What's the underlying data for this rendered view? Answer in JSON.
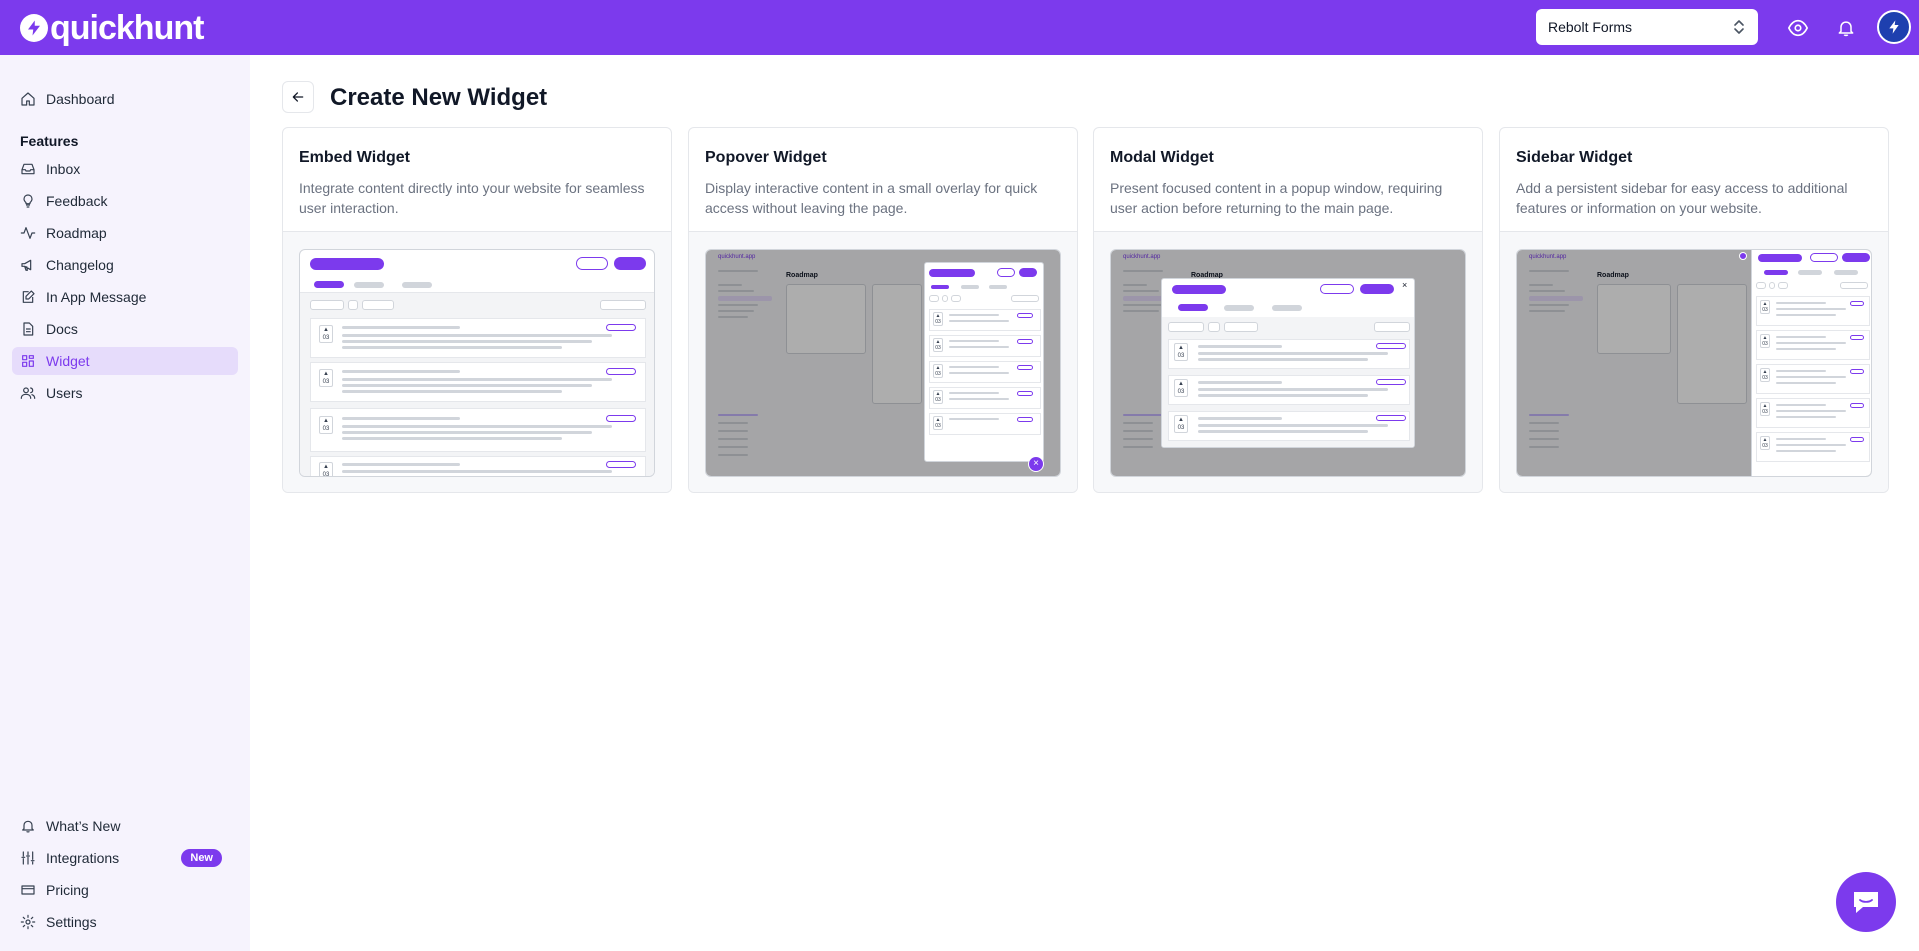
{
  "app": {
    "logo_text": "quickhunt",
    "project": "Rebolt Forms"
  },
  "sidebar": {
    "dashboard": "Dashboard",
    "features_label": "Features",
    "items": [
      {
        "label": "Inbox",
        "icon": "inbox-icon"
      },
      {
        "label": "Feedback",
        "icon": "lightbulb-icon"
      },
      {
        "label": "Roadmap",
        "icon": "activity-icon"
      },
      {
        "label": "Changelog",
        "icon": "megaphone-icon"
      },
      {
        "label": "In App Message",
        "icon": "message-edit-icon"
      },
      {
        "label": "Docs",
        "icon": "document-icon"
      },
      {
        "label": "Widget",
        "icon": "layout-icon",
        "active": true
      },
      {
        "label": "Users",
        "icon": "users-icon"
      }
    ],
    "bottom": [
      {
        "label": "What’s New",
        "icon": "bell-icon"
      },
      {
        "label": "Integrations",
        "icon": "integrations-icon",
        "badge": "New"
      },
      {
        "label": "Pricing",
        "icon": "credit-card-icon"
      },
      {
        "label": "Settings",
        "icon": "gear-icon"
      }
    ]
  },
  "main": {
    "title": "Create New Widget",
    "cards": [
      {
        "title": "Embed Widget",
        "description": "Integrate content directly into your website for seamless user interaction."
      },
      {
        "title": "Popover Widget",
        "description": "Display interactive content in a small overlay for quick access without leaving the page."
      },
      {
        "title": "Modal Widget",
        "description": "Present focused content in a popup window, requiring user action before returning to the main page."
      },
      {
        "title": "Sidebar Widget",
        "description": "Add a persistent sidebar for easy access to additional features or information on your website."
      }
    ]
  },
  "preview": {
    "brand": "quickhunt.app",
    "roadmap": "Roadmap",
    "vote_count": "03"
  },
  "colors": {
    "accent": "#7c3aed",
    "sidebar_bg": "#f6f3fd",
    "active_bg": "#e6dcfb"
  }
}
